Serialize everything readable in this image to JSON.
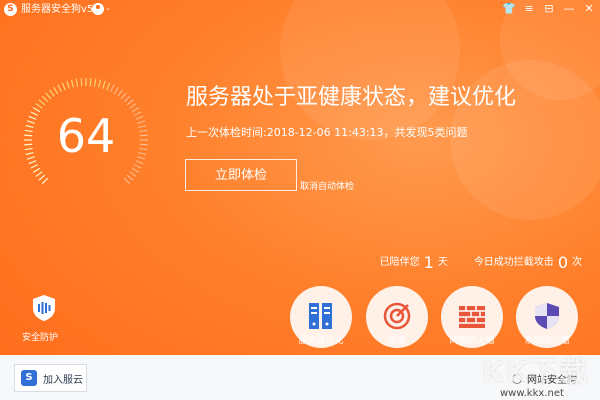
{
  "app": {
    "title": "服务器安全狗v5.0 -",
    "logo_char": "S"
  },
  "window_controls": {
    "skin": "👕",
    "menu": "≡",
    "mode": "⊟",
    "minimize": "—",
    "close": "✕"
  },
  "health": {
    "score": "64",
    "status_text": "服务器处于亚健康状态，建议优化",
    "last_check": "上一次体检时间:2018-12-06 11:43:13，共发现5类问题"
  },
  "actions": {
    "check_now": "立即体检",
    "cancel_auto": "取消自动体检"
  },
  "stats": {
    "protected_prefix": "已陪伴您",
    "protected_days": "1",
    "protected_unit": "天",
    "blocked_prefix": "今日成功拦截攻击",
    "blocked_count": "0",
    "blocked_unit": "次"
  },
  "protection": {
    "label": "安全防护",
    "icon": "shield-waves-icon"
  },
  "tools": [
    {
      "label": "服务器优化",
      "icon": "server-rack-icon"
    },
    {
      "label": "杀毒",
      "icon": "target-icon"
    },
    {
      "label": "网络防火墙",
      "icon": "brick-wall-icon"
    },
    {
      "label": "系统防火墙",
      "icon": "shield-icon"
    }
  ],
  "footer": {
    "join_cloud": "加入服云",
    "cloud_icon_char": "S",
    "firewall_label": "网站安全狗"
  },
  "watermark": {
    "text": "KK下载",
    "url": "www.kkx.net"
  },
  "colors": {
    "primary": "#ff6a1a",
    "tool_bg": "#fff1e8",
    "footer_bg": "#f7f8fa"
  }
}
